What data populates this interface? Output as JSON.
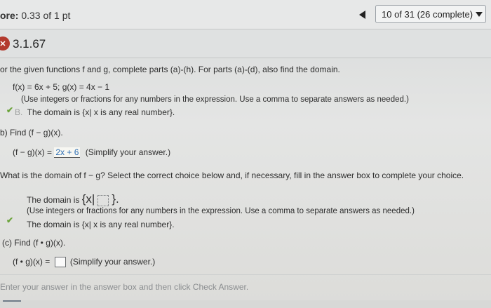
{
  "header": {
    "score_label": "ore:",
    "score_value": "0.33 of 1 pt",
    "progress": "10 of 31 (26 complete)"
  },
  "question": {
    "number": "3.1.67",
    "status_icon": "x-icon",
    "prompt": "or the given functions f and g, complete parts (a)-(h). For parts (a)-(d), also find the domain.",
    "functions": "f(x) = 6x + 5; g(x) = 4x − 1",
    "hint_a": "(Use integers or fractions for any numbers in the expression. Use a comma to separate answers as needed.)",
    "choice_b_letter": "B.",
    "choice_b_text": "The domain is {x| x is any real number}.",
    "part_b_title": "b) Find (f − g)(x).",
    "part_b_prefix": "(f − g)(x) =",
    "part_b_answer": "2x + 6",
    "part_b_hint": "(Simplify your answer.)",
    "domain_question": "What is the domain of f − g? Select the correct choice below and, if necessary, fill in the answer box to complete your choice.",
    "choice_a_text_prefix": "The domain is",
    "choice_a_brace_open": "{x|",
    "choice_a_brace_close": "}.",
    "choice_a_hint": "(Use integers or fractions for any numbers in the expression. Use a comma to separate answers as needed.)",
    "choice_b2_text": "The domain is {x| x is any real number}.",
    "part_c_title": "(c) Find (f • g)(x).",
    "part_c_prefix": "(f • g)(x) =",
    "part_c_hint": "(Simplify your answer.)",
    "footer_instruction": "Enter your answer in the answer box and then click Check Answer."
  },
  "colors": {
    "check_green": "#6ca43c",
    "answer_blue": "#2f6fb4",
    "incorrect_red": "#b33a2e"
  }
}
